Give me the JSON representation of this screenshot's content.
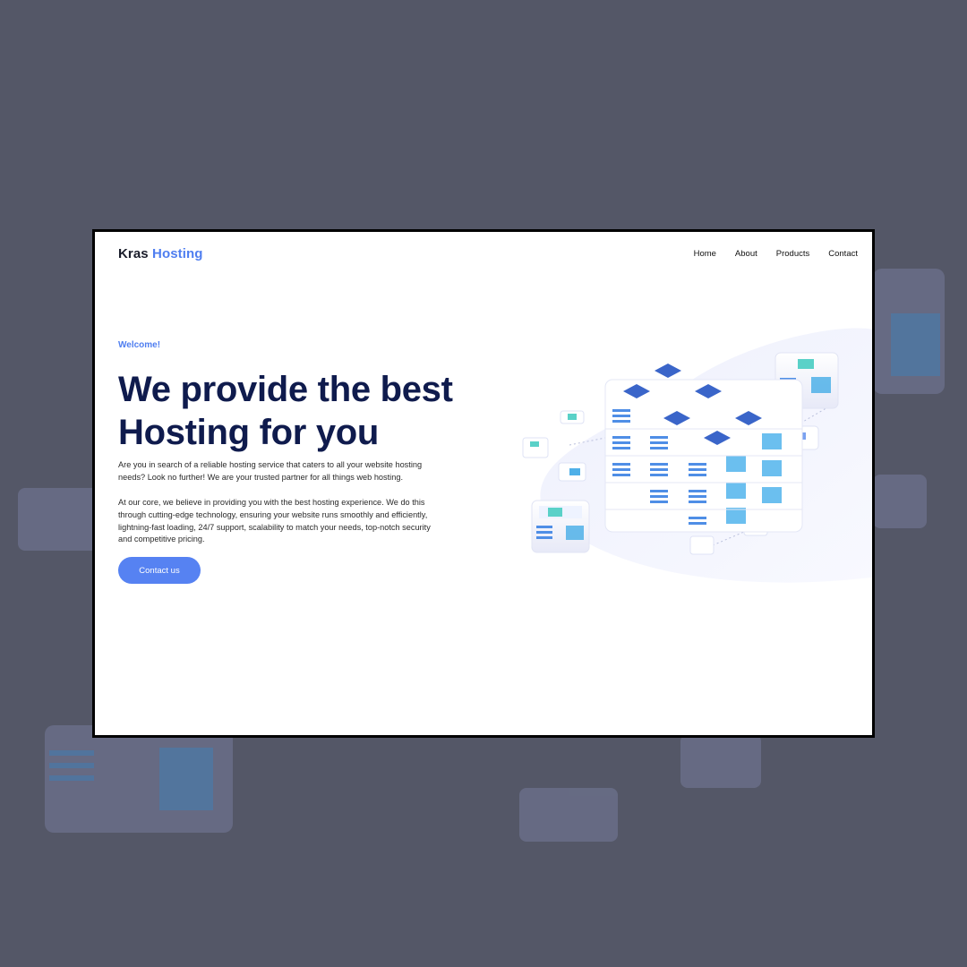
{
  "brand": {
    "name_dark": "Kras",
    "name_accent": "Hosting"
  },
  "nav": {
    "items": [
      "Home",
      "About",
      "Products",
      "Contact"
    ]
  },
  "hero": {
    "eyebrow": "Welcome!",
    "title_line1": "We provide the best",
    "title_line2": "Hosting for you",
    "paragraph1": "Are you in search of a reliable hosting service that caters to all your website hosting needs? Look no further! We are your trusted partner for all things web hosting.",
    "paragraph2": "At our core, we believe in providing you with the best hosting experience. We do this through cutting-edge technology, ensuring your website runs smoothly and efficiently, lightning-fast loading, 24/7 support, scalability to match your needs, top-notch security and competitive pricing.",
    "cta_label": "Contact us"
  },
  "colors": {
    "backdrop": "#545767",
    "accent": "#4f7ef0",
    "headline": "#0f1b4d",
    "button": "#5682f2"
  },
  "icons": [
    "server-cluster-illustration"
  ]
}
